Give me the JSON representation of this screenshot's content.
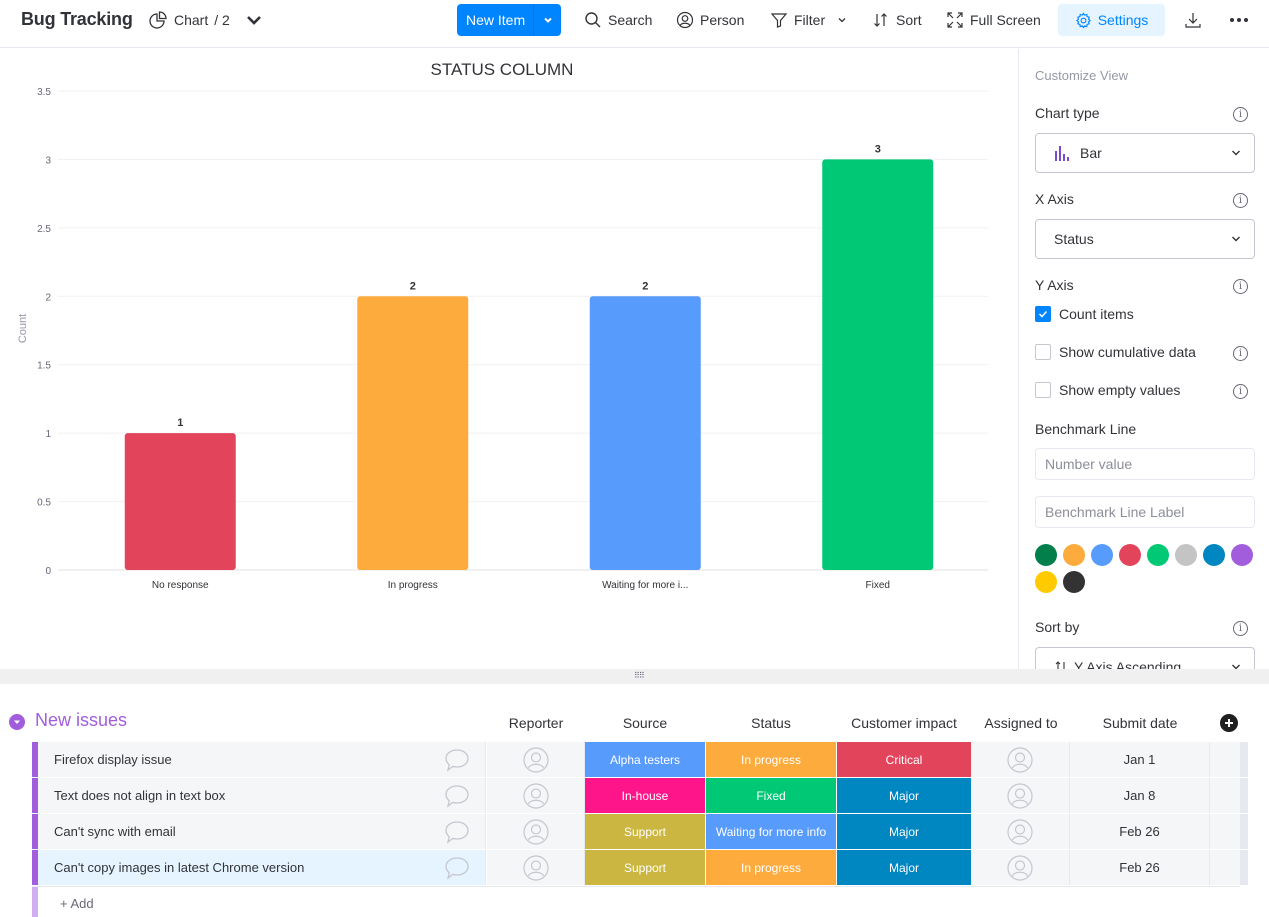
{
  "header": {
    "board_title": "Bug Tracking",
    "view_label": "Chart",
    "view_count": "/ 2",
    "new_item_label": "New Item",
    "tools": {
      "search": "Search",
      "person": "Person",
      "filter": "Filter",
      "sort": "Sort",
      "fullscreen": "Full Screen",
      "settings": "Settings"
    }
  },
  "chart_data": {
    "type": "bar",
    "title": "STATUS COLUMN",
    "xlabel": "",
    "ylabel": "Count",
    "ylim": [
      0,
      3.5
    ],
    "yticks": [
      "0",
      "0.5",
      "1",
      "1.5",
      "2",
      "2.5",
      "3",
      "3.5"
    ],
    "yticks_values": [
      0,
      0.5,
      1,
      1.5,
      2,
      2.5,
      3,
      3.5
    ],
    "categories": [
      "No response",
      "In progress",
      "Waiting for more i...",
      "Fixed"
    ],
    "values": [
      1,
      2,
      2,
      3
    ],
    "value_labels": [
      "1",
      "2",
      "2",
      "3"
    ],
    "colors": [
      "#e2445c",
      "#fdab3d",
      "#579bfc",
      "#00c875"
    ],
    "grid": true,
    "legend": "none"
  },
  "settings_panel": {
    "heading": "Customize View",
    "chart_type_label": "Chart type",
    "chart_type_value": "Bar",
    "x_axis_label": "X Axis",
    "x_axis_value": "Status",
    "y_axis_label": "Y Axis",
    "count_items_label": "Count items",
    "count_items_checked": true,
    "cumulative_label": "Show cumulative data",
    "cumulative_checked": false,
    "empty_values_label": "Show empty values",
    "empty_values_checked": false,
    "benchmark_label": "Benchmark Line",
    "benchmark_value_placeholder": "Number value",
    "benchmark_label_placeholder": "Benchmark Line Label",
    "benchmark_colors": [
      "#037f4c",
      "#fdab3d",
      "#579bfc",
      "#e2445c",
      "#00c875",
      "#c4c4c4",
      "#0086c0",
      "#a25ddc",
      "#ffcb00",
      "#333333"
    ],
    "sort_by_label": "Sort by",
    "sort_by_value": "Y Axis Ascending",
    "info_glyph": "i"
  },
  "table": {
    "group_title": "New issues",
    "group_color": "#a25ddc",
    "columns": [
      "Reporter",
      "Source",
      "Status",
      "Customer impact",
      "Assigned to",
      "Submit date"
    ],
    "rows": [
      {
        "name": "Firefox display issue",
        "source": "Alpha testers",
        "source_color": "#579bfc",
        "status": "In progress",
        "status_color": "#fdab3d",
        "impact": "Critical",
        "impact_color": "#e2445c",
        "date": "Jan 1"
      },
      {
        "name": "Text does not align in text box",
        "source": "In-house",
        "source_color": "#ff158a",
        "status": "Fixed",
        "status_color": "#00c875",
        "impact": "Major",
        "impact_color": "#0086c0",
        "date": "Jan 8"
      },
      {
        "name": "Can't sync with email",
        "source": "Support",
        "source_color": "#cab641",
        "status": "Waiting for more info",
        "status_color": "#579bfc",
        "impact": "Major",
        "impact_color": "#0086c0",
        "date": "Feb 26"
      },
      {
        "name": "Can't copy images in latest Chrome version",
        "source": "Support",
        "source_color": "#cab641",
        "status": "In progress",
        "status_color": "#fdab3d",
        "impact": "Major",
        "impact_color": "#0086c0",
        "date": "Feb 26"
      }
    ],
    "add_label": "+ Add"
  }
}
